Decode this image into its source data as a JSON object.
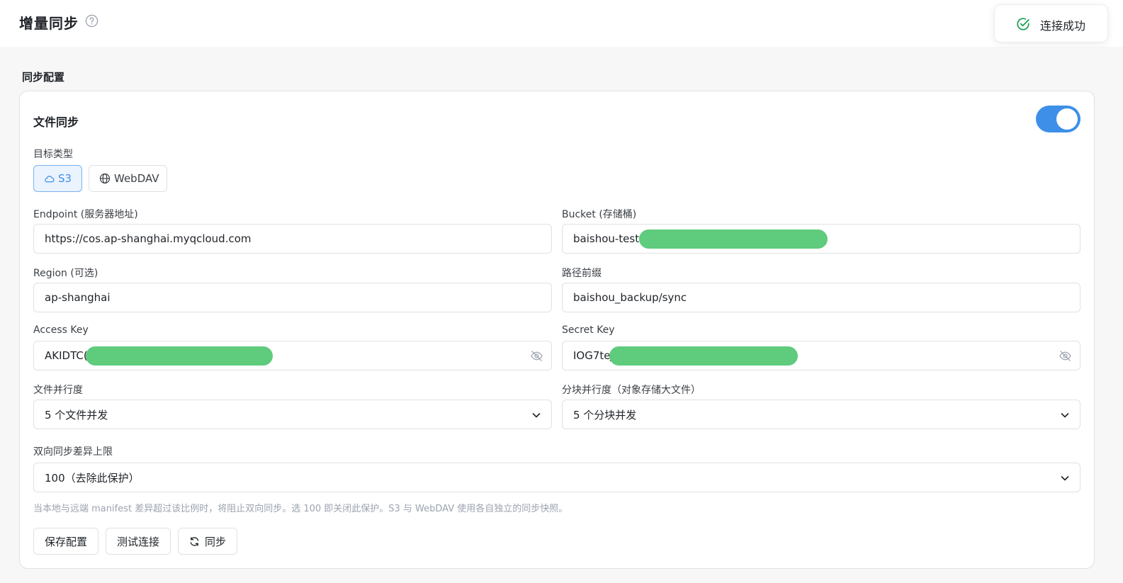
{
  "header": {
    "title": "增量同步",
    "toast": "连接成功"
  },
  "section": {
    "title": "同步配置"
  },
  "card": {
    "title": "文件同步",
    "enabled": true,
    "target_type_label": "目标类型",
    "target_types": [
      "S3",
      "WebDAV"
    ],
    "selected_target": "S3",
    "endpoint": {
      "label": "Endpoint (服务器地址)",
      "value": "https://cos.ap-shanghai.myqcloud.com"
    },
    "bucket": {
      "label": "Bucket (存储桶)",
      "value": "baishou-test-"
    },
    "region": {
      "label": "Region (可选)",
      "value": "ap-shanghai"
    },
    "prefix": {
      "label": "路径前缀",
      "value": "baishou_backup/sync"
    },
    "access_key": {
      "label": "Access Key",
      "value": "AKIDTC("
    },
    "secret_key": {
      "label": "Secret Key",
      "value": "IOG7teJ"
    },
    "file_concurrency": {
      "label": "文件并行度",
      "value": "5 个文件并发"
    },
    "chunk_concurrency": {
      "label": "分块并行度（对象存储大文件）",
      "value": "5 个分块并发"
    },
    "diff_limit": {
      "label": "双向同步差异上限",
      "value": "100（去除此保护）"
    },
    "hint": "当本地与远端 manifest 差异超过该比例时，将阻止双向同步。选 100 即关闭此保护。S3 与 WebDAV 使用各自独立的同步快照。",
    "buttons": {
      "save": "保存配置",
      "test": "测试连接",
      "sync": "同步"
    }
  },
  "colors": {
    "accent": "#3d8fe8",
    "success": "#22a35a",
    "redaction": "#5ecb7d"
  }
}
